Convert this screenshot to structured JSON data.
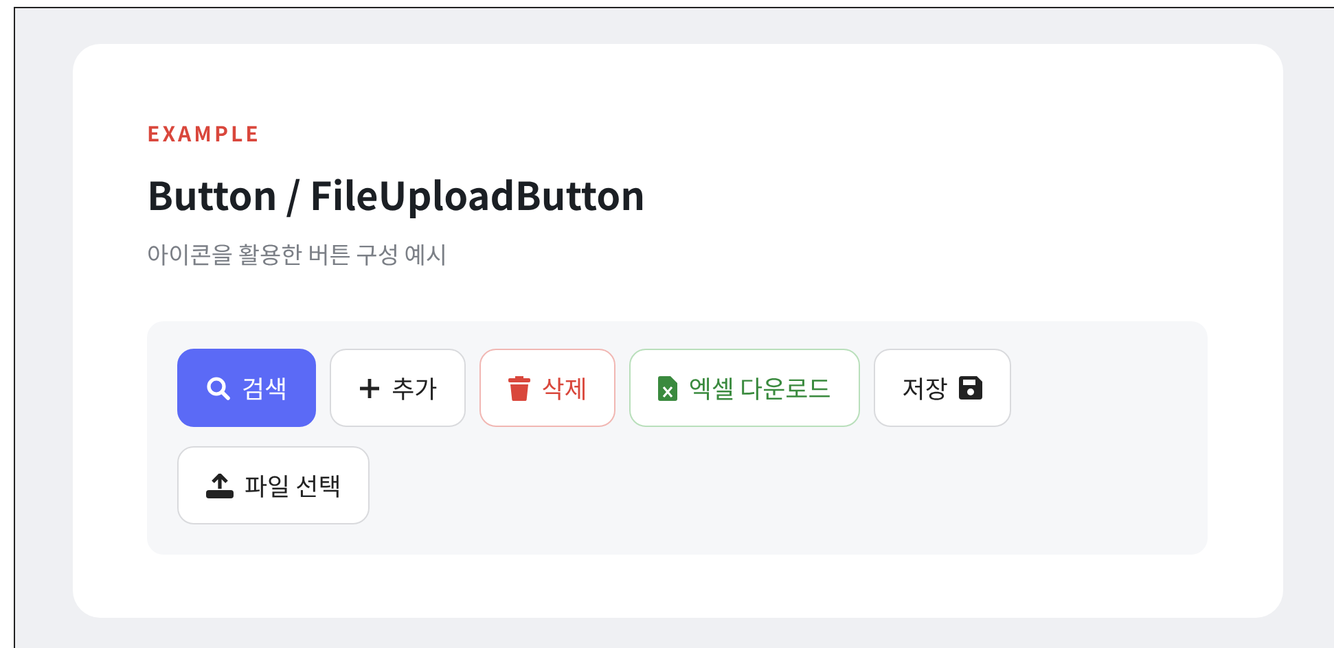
{
  "card": {
    "eyebrow": "EXAMPLE",
    "title": "Button / FileUploadButton",
    "subtitle": "아이콘을 활용한 버튼 구성 예시"
  },
  "buttons": [
    {
      "label": "검색",
      "kind": "primary"
    },
    {
      "label": "추가",
      "kind": "default"
    },
    {
      "label": "삭제",
      "kind": "danger"
    },
    {
      "label": "엑셀 다운로드",
      "kind": "success"
    },
    {
      "label": "저장",
      "kind": "default"
    },
    {
      "label": "파일 선택",
      "kind": "default"
    }
  ]
}
